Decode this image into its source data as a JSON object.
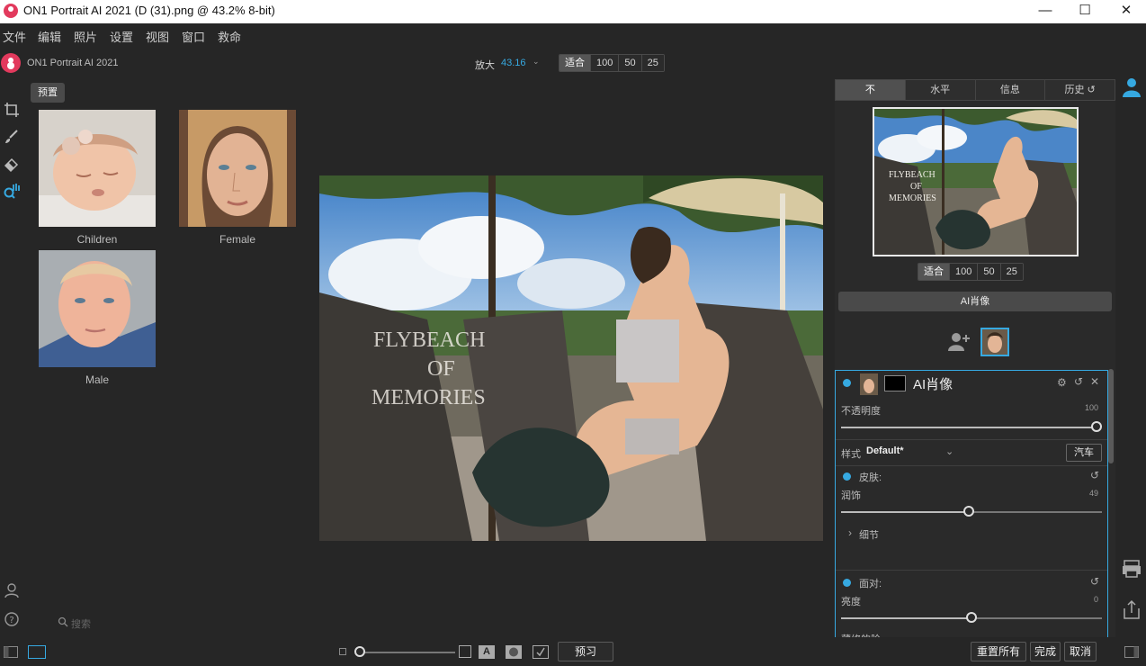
{
  "window": {
    "title": "ON1 Portrait AI 2021 (D (31).png @ 43.2% 8-bit)",
    "minimize": "—",
    "maximize": "☐",
    "close": "✕"
  },
  "menu": [
    "文件",
    "编辑",
    "照片",
    "设置",
    "视图",
    "窗口",
    "救命"
  ],
  "header": {
    "brand": "ON1 Portrait AI 2021",
    "zoom_label": "放大",
    "zoom_value": "43.16",
    "zoom_presets": [
      "适合",
      "100",
      "50",
      "25"
    ],
    "zoom_active": "适合"
  },
  "presets": {
    "tab": "预置",
    "items": [
      {
        "label": "Children"
      },
      {
        "label": "Female"
      },
      {
        "label": "Male"
      }
    ],
    "search_placeholder": "搜索"
  },
  "photo": {
    "watermark_lines": [
      "FLYBEACH",
      "OF",
      "MEMORIES"
    ]
  },
  "right_panel": {
    "tabs": [
      "不",
      "水平",
      "信息",
      "历史 ↺"
    ],
    "active_tab": "不",
    "nav_zoom_presets": [
      "适合",
      "100",
      "50",
      "25"
    ],
    "ai_portrait_button": "AI肖像",
    "adjustment": {
      "title": "AI肖像",
      "opacity_label": "不透明度",
      "opacity_value": "100",
      "opacity_fraction": 1.0,
      "style_label": "样式",
      "style_value": "Default*",
      "style_button": "汽车",
      "skin_label": "皮肤:",
      "smooth_label": "润饰",
      "smooth_value": "49",
      "smooth_fraction": 0.49,
      "detail_label": "细节",
      "face_label": "面对:",
      "brightness_label": "亮度",
      "brightness_value": "0",
      "brightness_fraction": 0.5,
      "cut_label": "薄修的脸"
    }
  },
  "bottom": {
    "preview_button": "预习",
    "reset_all": "重置所有",
    "done": "完成",
    "cancel": "取消"
  },
  "colors": {
    "accent": "#36a9e1",
    "brand": "#e23a5d",
    "background": "#262626"
  }
}
